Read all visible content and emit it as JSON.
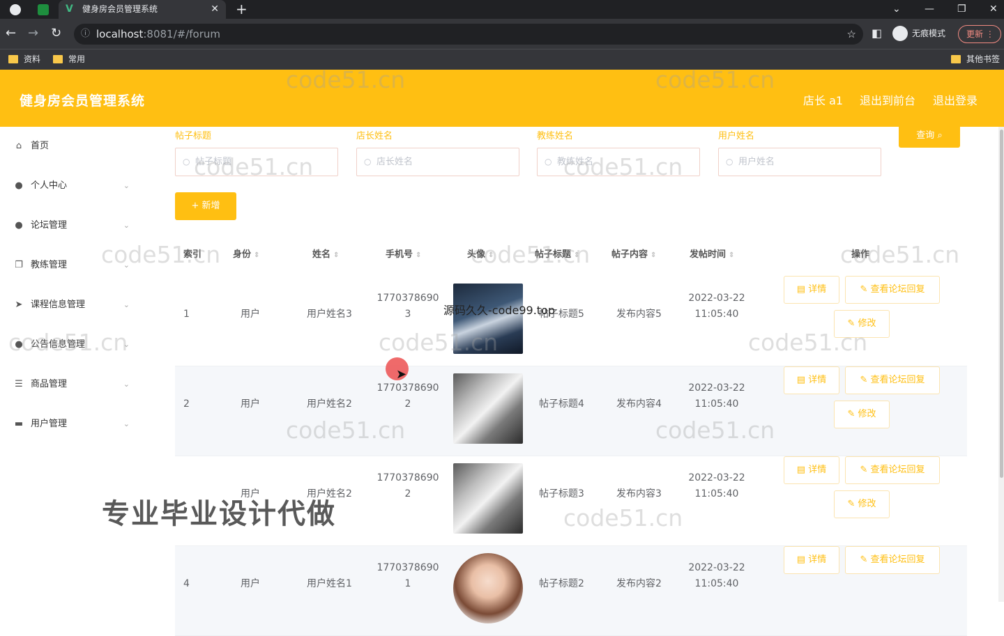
{
  "browser": {
    "tab_title": "健身房会员管理系统",
    "url_host": "localhost",
    "url_path": ":8081/#/forum",
    "incognito_label": "无痕模式",
    "update_label": "更新",
    "bookmarks": [
      "资料",
      "常用"
    ],
    "other_bookmarks": "其他书签"
  },
  "header": {
    "title": "健身房会员管理系统",
    "user_label": "店长 a1",
    "back_to_front": "退出到前台",
    "logout": "退出登录"
  },
  "sidebar": {
    "items": [
      {
        "label": "首页",
        "icon": "home-icon"
      },
      {
        "label": "个人中心",
        "icon": "user-icon"
      },
      {
        "label": "论坛管理",
        "icon": "bulb-icon"
      },
      {
        "label": "教练管理",
        "icon": "copy-icon"
      },
      {
        "label": "课程信息管理",
        "icon": "send-icon"
      },
      {
        "label": "公告信息管理",
        "icon": "user-icon"
      },
      {
        "label": "商品管理",
        "icon": "list-icon"
      },
      {
        "label": "用户管理",
        "icon": "camera-icon"
      }
    ]
  },
  "filters": [
    {
      "label": "帖子标题",
      "placeholder": "帖子标题"
    },
    {
      "label": "店长姓名",
      "placeholder": "店长姓名"
    },
    {
      "label": "教练姓名",
      "placeholder": "教练姓名"
    },
    {
      "label": "用户姓名",
      "placeholder": "用户姓名"
    }
  ],
  "actions": {
    "query": "查询",
    "add": "+ 新增"
  },
  "table": {
    "headers": [
      "索引",
      "身份",
      "姓名",
      "手机号",
      "头像",
      "帖子标题",
      "帖子内容",
      "发帖时间",
      "操作"
    ],
    "rows": [
      {
        "index": "1",
        "role": "用户",
        "name": "用户姓名3",
        "phone_a": "1770378690",
        "phone_b": "3",
        "title": "帖子标题5",
        "content": "发布内容5",
        "date": "2022-03-22",
        "time": "11:05:40",
        "avatar": "boy"
      },
      {
        "index": "2",
        "role": "用户",
        "name": "用户姓名2",
        "phone_a": "1770378690",
        "phone_b": "2",
        "title": "帖子标题4",
        "content": "发布内容4",
        "date": "2022-03-22",
        "time": "11:05:40",
        "avatar": "husky"
      },
      {
        "index": "",
        "role": "用户",
        "name": "用户姓名2",
        "phone_a": "1770378690",
        "phone_b": "2",
        "title": "帖子标题3",
        "content": "发布内容3",
        "date": "2022-03-22",
        "time": "11:05:40",
        "avatar": "husky"
      },
      {
        "index": "4",
        "role": "用户",
        "name": "用户姓名1",
        "phone_a": "1770378690",
        "phone_b": "1",
        "title": "帖子标题2",
        "content": "发布内容2",
        "date": "2022-03-22",
        "time": "11:05:40",
        "avatar": "girl"
      }
    ],
    "btn_detail": "详情",
    "btn_replies": "查看论坛回复",
    "btn_edit": "修改"
  },
  "overlays": {
    "watermark": "code51.cn",
    "slogan": "专业毕业设计代做",
    "source": "源码久久-code99.top"
  },
  "colors": {
    "primary": "#ffbf12",
    "browser_dark": "#202124",
    "browser_mid": "#35363a"
  }
}
